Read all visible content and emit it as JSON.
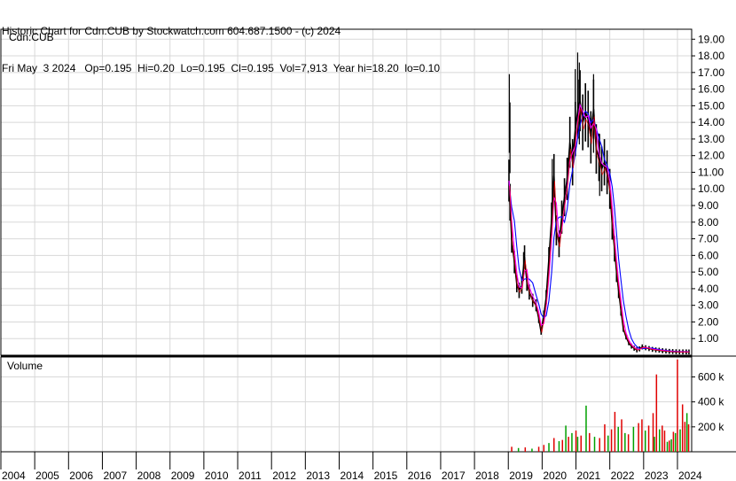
{
  "header": {
    "line1": "Historic Chart for Cdn:CUB by Stockwatch.com 604.687.1500 - (c) 2024",
    "line2": "Fri May  3 2024   Op=0.195  Hi=0.20  Lo=0.195  Cl=0.195  Vol=7,913  Year hi=18.20  lo=0.10"
  },
  "chart_data": {
    "type": "line",
    "symbol_label": "Cdn:CUB",
    "volume_label": "Volume",
    "x_tick_labels": [
      "2004",
      "2005",
      "2006",
      "2007",
      "2008",
      "2009",
      "2010",
      "2011",
      "2012",
      "2013",
      "2014",
      "2015",
      "2016",
      "2017",
      "2018",
      "2019",
      "2020",
      "2021",
      "2022",
      "2023",
      "2024"
    ],
    "price_axis_ticks": [
      "1.00",
      "2.00",
      "3.00",
      "4.00",
      "5.00",
      "6.00",
      "7.00",
      "8.00",
      "9.00",
      "10.00",
      "11.00",
      "12.00",
      "13.00",
      "14.00",
      "15.00",
      "16.00",
      "17.00",
      "18.00",
      "19.00"
    ],
    "volume_axis_ticks": [
      "200 k",
      "400 k",
      "600 k"
    ],
    "price_ylim": [
      0,
      19.6
    ],
    "volume_ylim": [
      0,
      760000
    ],
    "grid": true,
    "series": [
      {
        "values_note": "",
        "color": "#000000"
      }
    ],
    "price_points": [
      [
        2019.02,
        10.5
      ],
      [
        2019.05,
        9.2
      ],
      [
        2019.1,
        7.0
      ],
      [
        2019.18,
        5.6
      ],
      [
        2019.25,
        4.3
      ],
      [
        2019.32,
        3.9
      ],
      [
        2019.4,
        4.2
      ],
      [
        2019.48,
        5.9
      ],
      [
        2019.55,
        4.4
      ],
      [
        2019.62,
        3.8
      ],
      [
        2019.72,
        3.3
      ],
      [
        2019.82,
        3.0
      ],
      [
        2019.9,
        2.2
      ],
      [
        2019.97,
        1.4
      ],
      [
        2020.05,
        2.4
      ],
      [
        2020.12,
        3.5
      ],
      [
        2020.2,
        5.8
      ],
      [
        2020.28,
        8.2
      ],
      [
        2020.35,
        10.8
      ],
      [
        2020.42,
        7.5
      ],
      [
        2020.5,
        6.7
      ],
      [
        2020.58,
        8.3
      ],
      [
        2020.66,
        9.5
      ],
      [
        2020.74,
        10.6
      ],
      [
        2020.82,
        12.8
      ],
      [
        2020.9,
        11.6
      ],
      [
        2020.98,
        13.6
      ],
      [
        2021.06,
        14.8
      ],
      [
        2021.12,
        15.3
      ],
      [
        2021.2,
        14.0
      ],
      [
        2021.28,
        14.6
      ],
      [
        2021.36,
        14.2
      ],
      [
        2021.44,
        13.1
      ],
      [
        2021.52,
        14.8
      ],
      [
        2021.6,
        12.4
      ],
      [
        2021.68,
        11.9
      ],
      [
        2021.76,
        11.2
      ],
      [
        2021.84,
        11.6
      ],
      [
        2021.92,
        11.0
      ],
      [
        2022.0,
        10.0
      ],
      [
        2022.07,
        7.9
      ],
      [
        2022.14,
        6.4
      ],
      [
        2022.2,
        5.0
      ],
      [
        2022.26,
        3.9
      ],
      [
        2022.33,
        2.7
      ],
      [
        2022.4,
        1.6
      ],
      [
        2022.48,
        1.1
      ],
      [
        2022.56,
        0.75
      ],
      [
        2022.64,
        0.55
      ],
      [
        2022.72,
        0.42
      ],
      [
        2022.8,
        0.32
      ],
      [
        2022.88,
        0.38
      ],
      [
        2022.96,
        0.5
      ],
      [
        2023.06,
        0.45
      ],
      [
        2023.16,
        0.4
      ],
      [
        2023.26,
        0.35
      ],
      [
        2023.36,
        0.32
      ],
      [
        2023.46,
        0.3
      ],
      [
        2023.56,
        0.27
      ],
      [
        2023.66,
        0.25
      ],
      [
        2023.76,
        0.23
      ],
      [
        2023.86,
        0.22
      ],
      [
        2023.96,
        0.21
      ],
      [
        2024.06,
        0.2
      ],
      [
        2024.16,
        0.2
      ],
      [
        2024.26,
        0.2
      ],
      [
        2024.34,
        0.195
      ]
    ],
    "price_spikes": [
      [
        2019.03,
        16.9
      ],
      [
        2019.05,
        15.2
      ],
      [
        2020.3,
        11.8
      ],
      [
        2020.98,
        17.2
      ],
      [
        2021.05,
        18.2
      ],
      [
        2021.1,
        17.6
      ],
      [
        2021.52,
        16.9
      ],
      [
        2021.7,
        13.3
      ],
      [
        2019.45,
        6.2
      ]
    ],
    "volume_bars": [
      [
        2019.1,
        40000,
        "r"
      ],
      [
        2019.3,
        30000,
        "g"
      ],
      [
        2019.5,
        35000,
        "r"
      ],
      [
        2019.7,
        25000,
        "g"
      ],
      [
        2019.9,
        40000,
        "r"
      ],
      [
        2020.05,
        55000,
        "r"
      ],
      [
        2020.2,
        70000,
        "g"
      ],
      [
        2020.35,
        110000,
        "r"
      ],
      [
        2020.5,
        85000,
        "g"
      ],
      [
        2020.6,
        95000,
        "r"
      ],
      [
        2020.7,
        210000,
        "g"
      ],
      [
        2020.78,
        120000,
        "r"
      ],
      [
        2020.88,
        150000,
        "g"
      ],
      [
        2021.0,
        170000,
        "r"
      ],
      [
        2021.05,
        120000,
        "g"
      ],
      [
        2021.15,
        130000,
        "r"
      ],
      [
        2021.3,
        370000,
        "g"
      ],
      [
        2021.4,
        150000,
        "r"
      ],
      [
        2021.55,
        120000,
        "g"
      ],
      [
        2021.7,
        110000,
        "r"
      ],
      [
        2021.85,
        220000,
        "r"
      ],
      [
        2021.95,
        130000,
        "g"
      ],
      [
        2022.05,
        180000,
        "r"
      ],
      [
        2022.15,
        320000,
        "r"
      ],
      [
        2022.25,
        200000,
        "g"
      ],
      [
        2022.35,
        260000,
        "r"
      ],
      [
        2022.45,
        150000,
        "g"
      ],
      [
        2022.55,
        140000,
        "r"
      ],
      [
        2022.7,
        200000,
        "g"
      ],
      [
        2022.85,
        230000,
        "r"
      ],
      [
        2022.95,
        260000,
        "r"
      ],
      [
        2023.05,
        170000,
        "g"
      ],
      [
        2023.15,
        210000,
        "r"
      ],
      [
        2023.28,
        310000,
        "r"
      ],
      [
        2023.32,
        120000,
        "g"
      ],
      [
        2023.38,
        620000,
        "r"
      ],
      [
        2023.47,
        180000,
        "g"
      ],
      [
        2023.55,
        210000,
        "r"
      ],
      [
        2023.62,
        170000,
        "r"
      ],
      [
        2023.7,
        80000,
        "g"
      ],
      [
        2023.76,
        90000,
        "r"
      ],
      [
        2023.82,
        100000,
        "g"
      ],
      [
        2023.88,
        160000,
        "r"
      ],
      [
        2023.94,
        150000,
        "g"
      ],
      [
        2024.0,
        740000,
        "r"
      ],
      [
        2024.08,
        180000,
        "g"
      ],
      [
        2024.15,
        380000,
        "r"
      ],
      [
        2024.22,
        240000,
        "r"
      ],
      [
        2024.28,
        310000,
        "g"
      ],
      [
        2024.33,
        220000,
        "r"
      ]
    ],
    "colors": {
      "price": "#000000",
      "ma_fast": "#ff0000",
      "ma_mid": "#ff00ff",
      "ma_slow": "#0000ff",
      "vol_up": "#00a000",
      "vol_down": "#e00000",
      "grid": "#d8d8d8"
    }
  }
}
